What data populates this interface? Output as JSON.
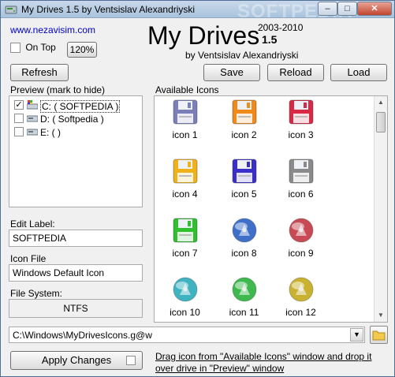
{
  "window": {
    "title": "My Drives 1.5 by Ventsislav Alexandriyski",
    "watermark": "SOFTPEDIA",
    "buttons": {
      "minimize": "–",
      "maximize": "□",
      "close": "✕"
    }
  },
  "header": {
    "website_link": "www.nezavisim.com",
    "on_top_label": "On Top",
    "zoom_label": "120%",
    "app_name": "My Drives",
    "years": "2003-2010",
    "version": "1.5",
    "byline": "by Ventsislav Alexandriyski"
  },
  "toolbar": {
    "refresh_label": "Refresh",
    "save_label": "Save",
    "reload_label": "Reload",
    "load_label": "Load"
  },
  "preview": {
    "heading": "Preview (mark to hide)",
    "drives": [
      {
        "label": "C:  ( SOFTPEDIA )",
        "checked": true
      },
      {
        "label": "D:  ( Softpedia )",
        "checked": false
      },
      {
        "label": "E:  (  )",
        "checked": false
      }
    ]
  },
  "available_icons": {
    "heading": "Available Icons",
    "icons": [
      {
        "label": "icon 1",
        "shape": "floppy",
        "color": "#7a7fb8"
      },
      {
        "label": "icon 2",
        "shape": "floppy",
        "color": "#f08a1a"
      },
      {
        "label": "icon 3",
        "shape": "floppy",
        "color": "#d82a45"
      },
      {
        "label": "icon 4",
        "shape": "floppy",
        "color": "#f0b21a"
      },
      {
        "label": "icon 5",
        "shape": "floppy",
        "color": "#3a2fc8"
      },
      {
        "label": "icon 6",
        "shape": "floppy",
        "color": "#8a8a8a"
      },
      {
        "label": "icon 7",
        "shape": "floppy",
        "color": "#2fbf2f"
      },
      {
        "label": "icon 8",
        "shape": "disc",
        "color": "#3f6fc8"
      },
      {
        "label": "icon 9",
        "shape": "disc",
        "color": "#c84a55"
      },
      {
        "label": "icon 10",
        "shape": "disc",
        "color": "#3fb3c0"
      },
      {
        "label": "icon 11",
        "shape": "disc",
        "color": "#3fb84f"
      },
      {
        "label": "icon 12",
        "shape": "disc",
        "color": "#c8b22f"
      }
    ]
  },
  "edit": {
    "edit_label_heading": "Edit Label:",
    "edit_label_value": "SOFTPEDIA",
    "icon_file_heading": "Icon File",
    "icon_file_value": "Windows Default Icon",
    "file_system_heading": "File System:",
    "file_system_value": "NTFS"
  },
  "footer": {
    "icon_path": "C:\\Windows\\MyDrivesIcons.g@w",
    "apply_label": "Apply Changes",
    "hint": "Drag icon from \"Available Icons\" window and drop it over drive in \"Preview\" window"
  }
}
